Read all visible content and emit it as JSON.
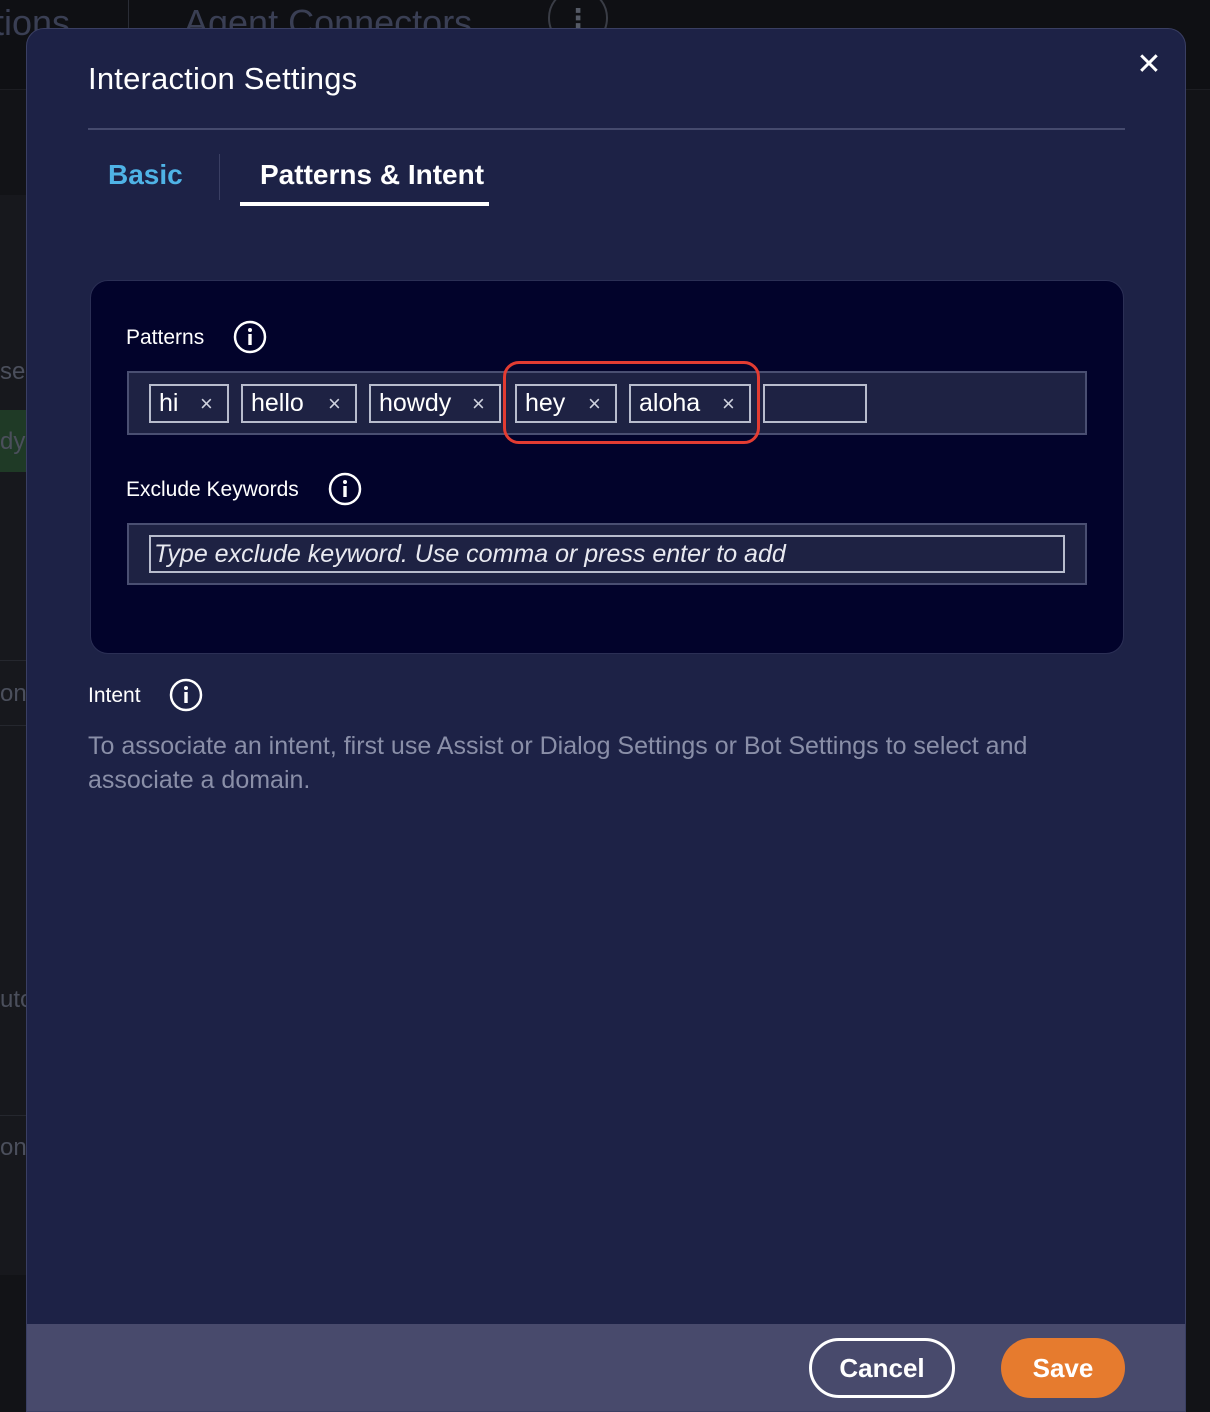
{
  "background": {
    "header_items": [
      "tions",
      "Agent Connectors"
    ],
    "kebab_icon": "vertical-ellipsis-icon",
    "side_fragments": [
      "se",
      "dy",
      "on",
      "uto",
      "on"
    ]
  },
  "modal": {
    "title": "Interaction Settings",
    "close_icon": "close-icon",
    "tabs": {
      "basic": "Basic",
      "patterns_intent": "Patterns & Intent",
      "active": "patterns_intent"
    },
    "patterns": {
      "label": "Patterns",
      "info_icon": "info-icon",
      "chips": [
        {
          "text": "hi",
          "remove": "×"
        },
        {
          "text": "hello",
          "remove": "×"
        },
        {
          "text": "howdy",
          "remove": "×"
        },
        {
          "text": "hey",
          "remove": "×"
        },
        {
          "text": "aloha",
          "remove": "×"
        }
      ],
      "highlighted_chips": [
        "hey",
        "aloha"
      ],
      "new_chip_value": ""
    },
    "exclude_keywords": {
      "label": "Exclude Keywords",
      "info_icon": "info-icon",
      "value": "",
      "placeholder": "Type exclude keyword. Use comma or press enter to add"
    },
    "intent": {
      "label": "Intent",
      "info_icon": "info-icon",
      "description": "To associate an intent, first use Assist or Dialog Settings or Bot Settings to select and associate a domain."
    },
    "footer": {
      "cancel_label": "Cancel",
      "save_label": "Save"
    }
  },
  "colors": {
    "modal_bg": "#1d2246",
    "panel_bg": "#02032b",
    "tab_active_color": "#ffffff",
    "tab_inactive_color": "#4fb3e6",
    "highlight_border": "#e23c32",
    "save_button": "#e67b2e",
    "footer_bg": "#484a6c"
  }
}
